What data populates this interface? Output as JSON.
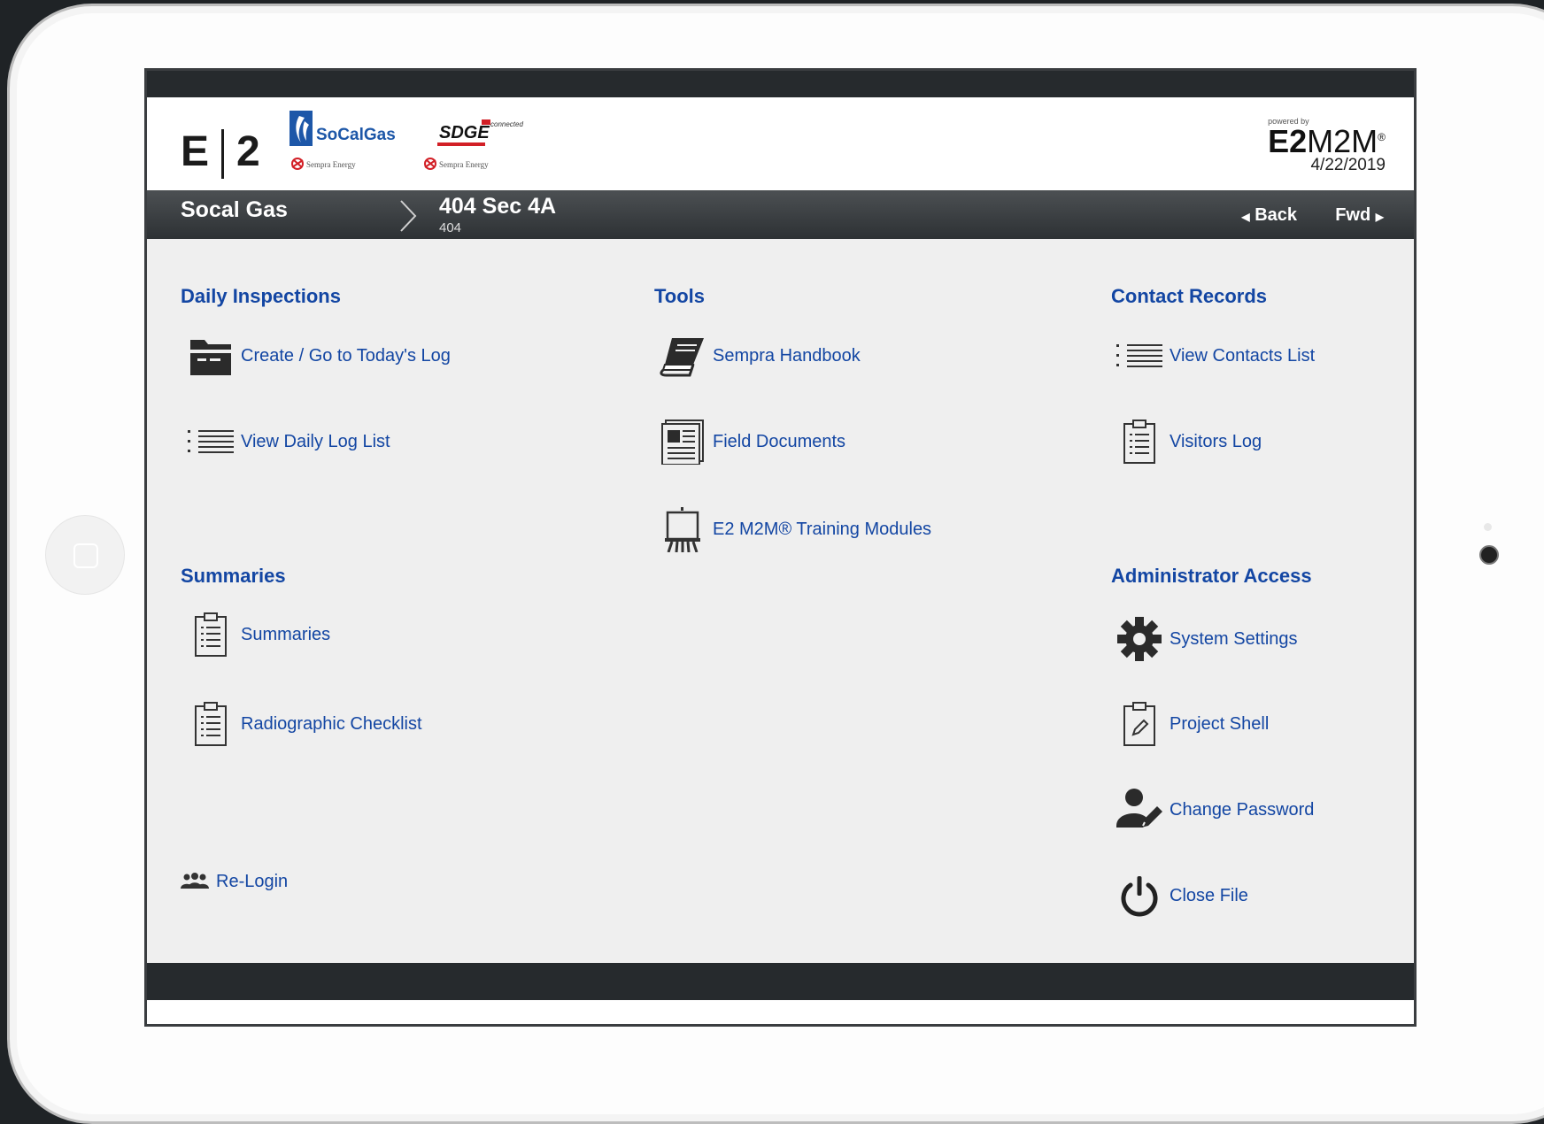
{
  "header": {
    "logo_e": "E",
    "logo_2": "2",
    "socalgas": "SoCalGas",
    "sempra_tag": "Sempra Energy",
    "sdge": "SDGE",
    "sdge_connected": "connected",
    "powered_by": "powered by",
    "product_bold": "E2",
    "product_rest": "M2M",
    "product_mark": "®",
    "date": "4/22/2019"
  },
  "nav": {
    "title": "Socal Gas",
    "subtitle": "404 Sec 4A",
    "code": "404",
    "back": "Back",
    "fwd": "Fwd"
  },
  "sections": {
    "daily": {
      "heading": "Daily Inspections",
      "items": [
        "Create / Go to Today's Log",
        "View Daily Log List"
      ]
    },
    "summaries": {
      "heading": "Summaries",
      "items": [
        "Summaries",
        "Radiographic Checklist"
      ]
    },
    "tools": {
      "heading": "Tools",
      "items": [
        "Sempra Handbook",
        "Field Documents",
        "E2 M2M® Training Modules"
      ]
    },
    "contacts": {
      "heading": "Contact Records",
      "items": [
        "View Contacts List",
        "Visitors Log"
      ]
    },
    "admin": {
      "heading": "Administrator Access",
      "items": [
        "System Settings",
        "Project Shell",
        "Change Password",
        "Close File"
      ]
    },
    "relogin": "Re-Login"
  },
  "colors": {
    "link": "#1346a3",
    "navbar": "#3a3e41",
    "content_bg": "#efefef",
    "socal_blue": "#1d57a8",
    "sdge_red": "#d21f26"
  }
}
